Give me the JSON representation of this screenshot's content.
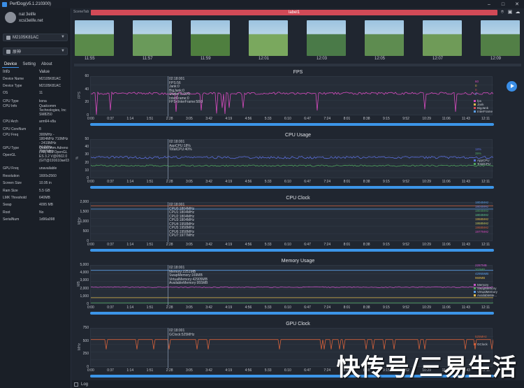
{
  "window": {
    "title": "PerfDog(v5.1.210300)"
  },
  "user": {
    "name": "nat 3elife",
    "email": "xcsi3elife.net"
  },
  "device_select": {
    "value": "M2105K81AC"
  },
  "app_select": {
    "value": "原神"
  },
  "tabs": [
    "Device",
    "Setting",
    "About"
  ],
  "info_header": {
    "key": "Info",
    "value": "Value"
  },
  "info_rows": [
    {
      "k": "Device Name",
      "v": "M2105K81AC"
    },
    {
      "k": "Device Type",
      "v": "M2105K81AC"
    },
    {
      "k": "OS",
      "v": "11"
    },
    {
      "k": "CPU Type",
      "v": "kona"
    },
    {
      "k": "CPU Info",
      "v": "Qualcomm Technologies, Inc SM8250"
    },
    {
      "k": "CPU Arch",
      "v": "arm64-v8a"
    },
    {
      "k": "CPU CoreNum",
      "v": "8"
    },
    {
      "k": "CPU Freq",
      "v": "300MHz - 1804MHz 710MHz - 2419MHz 844MHz - 3187MHz"
    },
    {
      "k": "GPU Type",
      "v": "Qualcomm Adreno (TM) 650 OpenGL ES 3.2 V@0502.0 (GIT@191610ae03"
    },
    {
      "k": "OpenGL",
      "v": ""
    },
    {
      "k": "GPU Freq",
      "v": "unavailable"
    },
    {
      "k": "Resolution",
      "v": "1600x2560"
    },
    {
      "k": "Screen Size",
      "v": "10.95 in"
    },
    {
      "k": "Ram Size",
      "v": "5.5 GB"
    },
    {
      "k": "LMK Threshold",
      "v": "640MB"
    },
    {
      "k": "Swap",
      "v": "4095 MB"
    },
    {
      "k": "Root",
      "v": "No"
    },
    {
      "k": "SerialNum",
      "v": "1d96a098"
    }
  ],
  "scene": {
    "tab_label": "SceneTab",
    "label": "label1"
  },
  "thumbs": {
    "times": [
      "11:55",
      "11:57",
      "11:59",
      "12:01",
      "12:03",
      "12:05",
      "12:07",
      "12:09"
    ],
    "colors": [
      "#5a8a4a",
      "#6a9a5a",
      "#4f7f3f",
      "#7aa85e",
      "#4a7a48",
      "#5e8c50",
      "#6f9b58",
      "#527f46"
    ]
  },
  "x_ticks": [
    "0:00",
    "0:37",
    "1:14",
    "1:51",
    "2:28",
    "3:05",
    "3:42",
    "4:19",
    "4:56",
    "5:33",
    "6:10",
    "6:47",
    "7:24",
    "8:01",
    "8:38",
    "9:15",
    "9:52",
    "10:29",
    "11:06",
    "11:43",
    "12:11"
  ],
  "colors": {
    "accent": "#3a8ee6",
    "fps": "#d64bbf",
    "cpu_app": "#5b6fdc",
    "cpu_total": "#4fa35e",
    "mem": "#c855c8",
    "gpu": "#d2603a",
    "label": "#d24a57"
  },
  "charts": {
    "fps": {
      "title": "FPS",
      "ylabel": "FPS",
      "yticks": [
        "60",
        "40",
        "20",
        "0"
      ],
      "readout": [
        "02:18:001",
        "FPS:56",
        "Jank:0",
        "BigJank:0",
        "Stutter:0.00%",
        "InterFrame:0",
        "FPS<InterFrame:58.0"
      ],
      "legend": [
        {
          "val": "60",
          "name": "fps",
          "color": "#d64bbf"
        },
        {
          "val": "0",
          "name": "Jank",
          "color": "#e0b94a"
        },
        {
          "val": "0",
          "name": "BigJank",
          "color": "#d24a57"
        },
        {
          "val": "0",
          "name": "InterFrame",
          "color": "#5b9ee6"
        }
      ]
    },
    "cpu": {
      "title": "CPU Usage",
      "ylabel": "%",
      "yticks": [
        "50",
        "40",
        "30",
        "20",
        "10",
        "0"
      ],
      "readout": [
        "02:18:001",
        "AppCPU:18%",
        "TotalCPU:40%"
      ],
      "legend": [
        {
          "val": "18%",
          "name": "AppCPU",
          "color": "#5b6fdc"
        },
        {
          "val": "39%",
          "name": "TotalCPU",
          "color": "#4fa35e"
        }
      ]
    },
    "clock": {
      "title": "CPU Clock",
      "ylabel": "MHz",
      "yticks": [
        "2,000",
        "1,500",
        "1,000",
        "500",
        "0"
      ],
      "readout": [
        "02:18:001",
        "CPU0:1804MHz",
        "CPU1:1804MHz",
        "CPU2:1804MHz",
        "CPU3:1804MHz",
        "CPU4:1958MHz",
        "CPU5:1958MHz",
        "CPU6:1958MHz",
        "CPU7:1977MHz"
      ],
      "legend": [
        {
          "val": "1804MHz",
          "color": "#5b9ee6"
        },
        {
          "val": "1804MHz",
          "color": "#6a8ae0"
        },
        {
          "val": "1804MHz",
          "color": "#4fa35e"
        },
        {
          "val": "1804MHz",
          "color": "#5bc48a"
        },
        {
          "val": "1958MHz",
          "color": "#e0b94a"
        },
        {
          "val": "1958MHz",
          "color": "#c8c85a"
        },
        {
          "val": "1958MHz",
          "color": "#d2603a"
        },
        {
          "val": "1977MHz",
          "color": "#d64bbf"
        }
      ]
    },
    "mem": {
      "title": "Memory Usage",
      "ylabel": "MB",
      "yticks": [
        "5,000",
        "4,000",
        "3,000",
        "2,000",
        "1,000",
        "0"
      ],
      "readout": [
        "02:18:001",
        "Memory:2251MB",
        "SwapMemory:169MB",
        "VirtualMemory:42905MB",
        "AvailableMemory:955MB"
      ],
      "legend": [
        {
          "val": "2287MB",
          "name": "Memory",
          "color": "#c855c8"
        },
        {
          "val": "203MB",
          "name": "SwapMemory",
          "color": "#4fa35e"
        },
        {
          "val": "42955MB",
          "name": "VirtualMemory",
          "color": "#5b9ee6"
        },
        {
          "val": "969MB",
          "name": "AvailableMe...",
          "color": "#e0b94a"
        }
      ]
    },
    "gpu": {
      "title": "GPU Clock",
      "ylabel": "MHz",
      "yticks": [
        "750",
        "500",
        "250",
        "0"
      ],
      "readout": [
        "02:18:001",
        "GClock:525MHz"
      ],
      "legend": [
        {
          "val": "525MHz",
          "name": "GClock",
          "color": "#d2603a"
        }
      ]
    }
  },
  "footer": {
    "log": "Log"
  },
  "watermark": "快传号/三易生活"
}
